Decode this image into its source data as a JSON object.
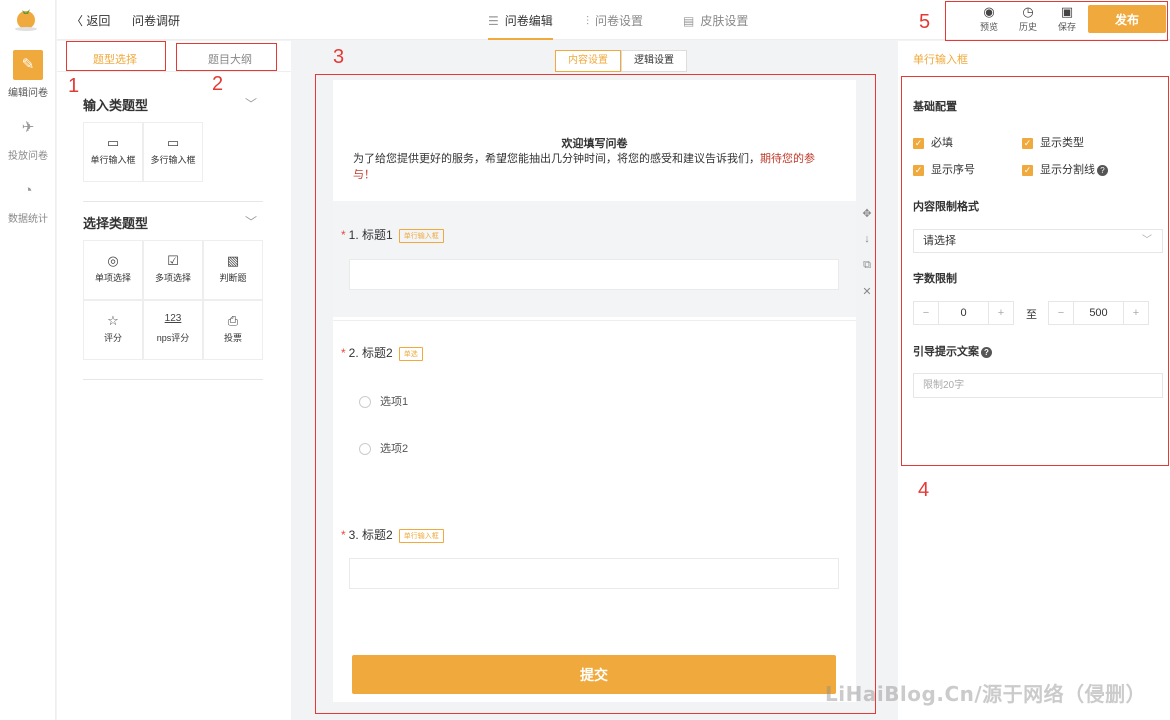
{
  "rail": {
    "items": [
      {
        "label": "编辑问卷",
        "icon": "pencil-icon",
        "glyph": "✎"
      },
      {
        "label": "投放问卷",
        "icon": "send-icon",
        "glyph": "✈"
      },
      {
        "label": "数据统计",
        "icon": "chart-pie-icon",
        "glyph": "◔"
      }
    ]
  },
  "topbar": {
    "back": "返回",
    "title": "问卷调研",
    "tabs": [
      {
        "label": "问卷编辑",
        "glyph": "☰"
      },
      {
        "label": "问卷设置",
        "glyph": "⫶"
      },
      {
        "label": "皮肤设置",
        "glyph": "▤"
      }
    ],
    "actions": [
      {
        "label": "预览",
        "glyph": "◉"
      },
      {
        "label": "历史",
        "glyph": "◷"
      },
      {
        "label": "保存",
        "glyph": "▣"
      }
    ],
    "publish": "发布"
  },
  "left": {
    "tabs": [
      "题型选择",
      "题目大纲"
    ],
    "sections": [
      {
        "title": "输入类题型",
        "items": [
          {
            "label": "单行输入框",
            "glyph": "▭"
          },
          {
            "label": "多行输入框",
            "glyph": "▭"
          }
        ]
      },
      {
        "title": "选择类题型",
        "items": [
          {
            "label": "单项选择",
            "glyph": "◎"
          },
          {
            "label": "多项选择",
            "glyph": "☑"
          },
          {
            "label": "判断题",
            "glyph": "▧"
          },
          {
            "label": "评分",
            "glyph": "☆"
          },
          {
            "label": "nps评分",
            "glyph": "123"
          },
          {
            "label": "投票",
            "glyph": "⎙"
          }
        ]
      }
    ]
  },
  "center": {
    "tabs": [
      "内容设置",
      "逻辑设置"
    ],
    "welcome": "欢迎填写问卷",
    "desc": "为了给您提供更好的服务，希望您能抽出几分钟时间，将您的感受和建议告诉我们，",
    "desc_highlight": "期待您的参与！",
    "questions": [
      {
        "title": "1. 标题1",
        "badge": "单行输入框"
      },
      {
        "title": "2. 标题2",
        "badge": "单选",
        "options": [
          "选项1",
          "选项2"
        ]
      },
      {
        "title": "3. 标题2",
        "badge": "单行输入框"
      }
    ],
    "submit": "提交",
    "tools": [
      "✥",
      "↓",
      "⧉",
      "✕"
    ]
  },
  "right": {
    "header": "单行输入框",
    "basic": "基础配置",
    "checks": [
      "必填",
      "显示类型",
      "显示序号",
      "显示分割线"
    ],
    "format_label": "内容限制格式",
    "format_placeholder": "请选择",
    "count_label": "字数限制",
    "min": "0",
    "max": "500",
    "to": "至",
    "hint_label": "引导提示文案",
    "hint_placeholder": "限制20字"
  },
  "annotations": [
    "1",
    "2",
    "3",
    "4",
    "5"
  ],
  "watermark": "LiHaiBlog.Cn/源于网络（侵删）",
  "colors": {
    "accent": "#f0a93c",
    "annotation": "#e53935"
  }
}
